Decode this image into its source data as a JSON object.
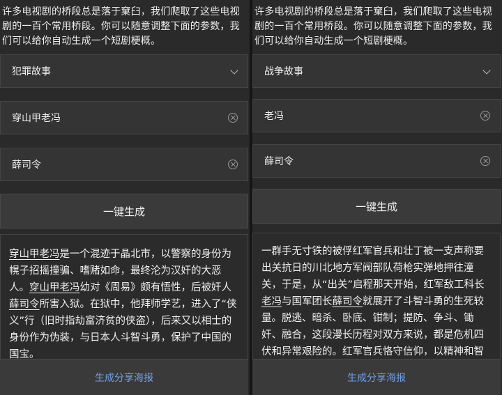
{
  "left": {
    "intro": "许多电视剧的桥段总是落于窠臼，我们爬取了这些电视剧的一百个常用桥段。你可以随意调整下面的参数，我们可以给你自动生成一个短剧梗概。",
    "genre": "犯罪故事",
    "name1": "穿山甲老冯",
    "name2": "薛司令",
    "generate_label": "一键生成",
    "result": {
      "p1": "穿山甲老冯",
      "p2": "是一个混迹于晶北市，以警察的身份为幌子招摇撞骗、嗜赌如命，最终沦为汉奸的大恶人。",
      "p3": "穿山甲老冯",
      "p4": "幼对《周易》颇有悟性，后被奸人",
      "p5": "薛司令",
      "p6": "所害入狱。在狱中，他拜师学艺，进入了“侠义”行（旧时指劫富济贫的侠盗），后来又以相士的身份作为伪装，与日本人斗智斗勇，保护了中国的国宝。"
    },
    "share_label": "生成分享海报"
  },
  "right": {
    "intro": "许多电视剧的桥段总是落于窠臼，我们爬取了这些电视剧的一百个常用桥段。你可以随意调整下面的参数，我们可以给你自动生成一个短剧梗概。",
    "genre": "战争故事",
    "name1": "老冯",
    "name2": "薛司令",
    "generate_label": "一键生成",
    "result": {
      "p1": "一群手无寸铁的被俘红军官兵和壮丁被一支声称要出关抗日的川北地方军阀部队荷枪实弹地押往潼关，于是，从“出关”启程那天开始，红军敌工科长",
      "p2": "老冯",
      "p3": "与国军团长",
      "p4": "薛司令",
      "p5": "就展开了斗智斗勇的生死较量。脱逃、暗杀、卧底、钳制；提防、争斗、锄奸、融合，这段漫长历程对双方来说，都是危机四伏和异常艰险的。红军官兵恪守信仰，以精神和智慧突围，与敌智斗，攻破敌心......"
    },
    "share_label": "生成分享海报"
  },
  "icons": {
    "dropdown": "chevron-down-icon",
    "clear": "clear-circle-icon"
  },
  "colors": {
    "link": "#6fa0e8",
    "background": "#2a2a2a"
  }
}
